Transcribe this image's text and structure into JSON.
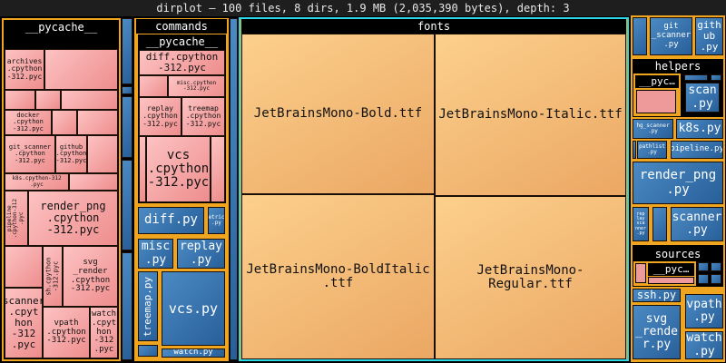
{
  "title": "dirplot — 100 files, 8 dirs, 1.9 MB (2,035,390 bytes), depth: 3",
  "dirs": {
    "pycache": "__pycache__",
    "commands": "commands",
    "commands_pycache": "__pycache__",
    "fonts": "fonts",
    "helpers": "helpers",
    "helpers_pycache": "__pyc…",
    "sources": "sources",
    "sources_pycache": "__pyc…"
  },
  "pycache_files": {
    "archives": "archives\n.cpython\n-312.pyc",
    "docker": "docker\n.cpython\n-312.pyc",
    "git_scanner": "git_scanner\n.cpython\n-312.pyc",
    "github": "github\n.cpython\n-312.pyc",
    "k8s": "k8s.cpython-312\n.pyc",
    "pipeline": "pipeline\n.cpython-312\n.pyc",
    "render_png": "render_png\n.cpython\n-312.pyc",
    "sh": "sh.cpython\n-312.pyc",
    "svg_render": "svg\n_render\n.cpython\n-312.pyc",
    "scanner": "scanner\n.cpyt\nhon\n-312\n.pyc",
    "vpath": "vpath\n.cpython\n-312.pyc",
    "watch": "watch\n.cpyt\nhon\n-312\n.pyc"
  },
  "commands_files": {
    "diff_pyc": "diff.cpython\n-312.pyc",
    "misc_pyc": "misc.cpython\n-312.pyc",
    "replay_pyc": "replay\n.cpython\n-312.pyc",
    "treemap_pyc": "treemap\n.cpython\n-312.pyc",
    "vcs_pyc": "vcs\n.cpython\n-312.pyc",
    "diff_py": "diff.py",
    "metrics_py": "metrics\n.py",
    "misc_py": "misc\n.py",
    "replay_py": "replay\n.py",
    "treemap_py": "treemap.py",
    "vcs_py": "vcs.py",
    "watch_py": "watch.py"
  },
  "fonts_files": {
    "bold": "JetBrainsMono-Bold.ttf",
    "italic": "JetBrainsMono-Italic.ttf",
    "bolditalic": "JetBrainsMono-BoldItalic\n.ttf",
    "regular": "JetBrainsMono-Regular.ttf"
  },
  "right_files": {
    "git_scanner": "git\n_scanner\n.py",
    "github": "gith\nub\n.py",
    "scan": "scan\n.py",
    "hg_scanner": "hg_scanner\n.py",
    "k8s": "k8s.py",
    "pathlist": "pathlist\n.py",
    "pipeline": "pipeline.py",
    "render_png": "render_png\n.py",
    "replay_scanner": "rep\nlay\nsca\nnner\n.py",
    "scanner": "scanner\n.py",
    "ssh": "ssh.py",
    "svg_render": "svg\n_rende\nr.py",
    "vpath": "vpath\n.py",
    "watch": "watch\n.py"
  },
  "colors": {
    "directory": "#f0a520",
    "pyc": "#f4a8a8",
    "py": "#3a74b0",
    "ttf": "#f6bf7c",
    "selected_outline": "#2ad9e8"
  }
}
